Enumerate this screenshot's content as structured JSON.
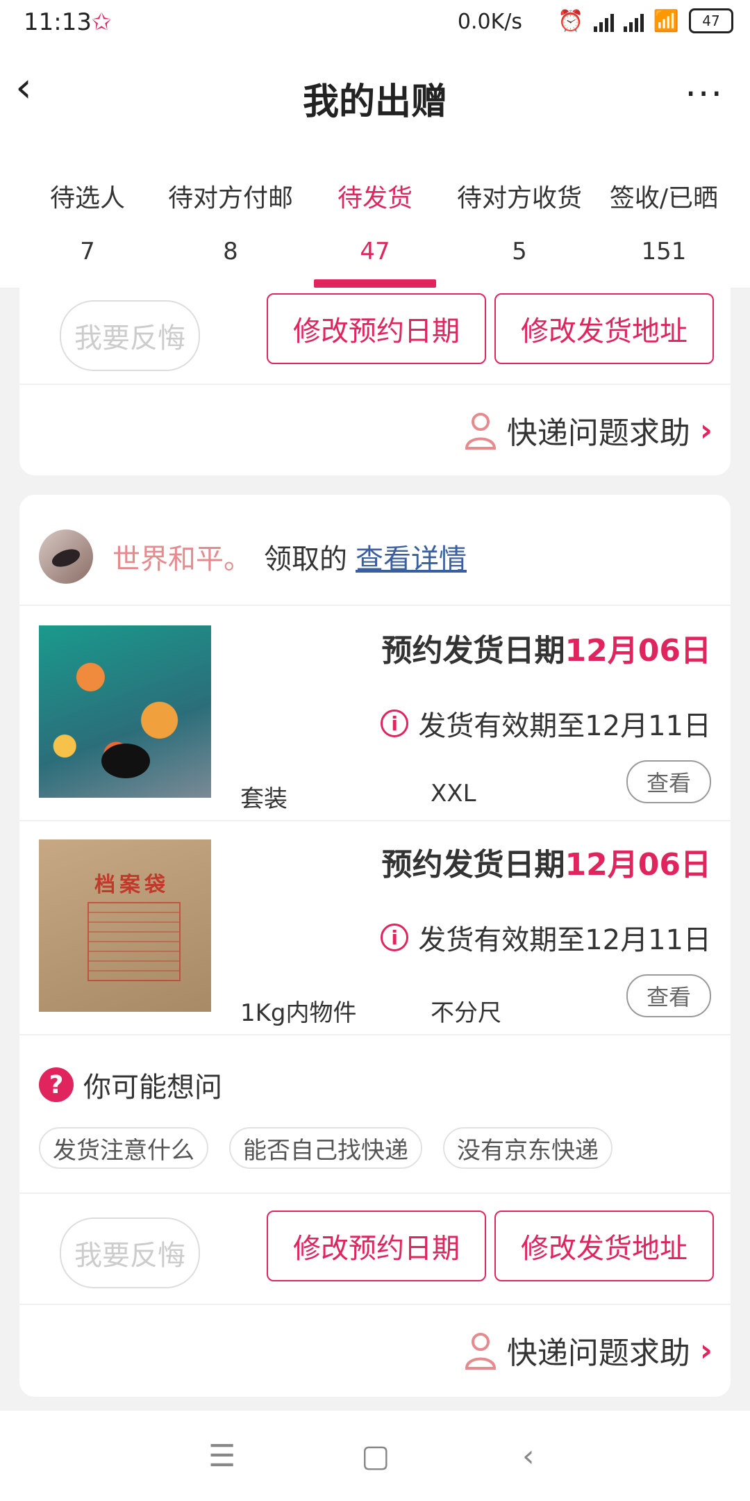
{
  "status_bar": {
    "time": "11:13",
    "network_speed": "0.0K/s",
    "battery": "47"
  },
  "header": {
    "title": "我的出赠"
  },
  "tabs": [
    {
      "label": "待选人",
      "count": "7"
    },
    {
      "label": "待对方付邮",
      "count": "8"
    },
    {
      "label": "待发货",
      "count": "47",
      "active": true
    },
    {
      "label": "待对方收货",
      "count": "5"
    },
    {
      "label": "签收/已晒",
      "count": "151"
    }
  ],
  "actions": {
    "regret": "我要反悔",
    "change_date": "修改预约日期",
    "change_address": "修改发货地址",
    "courier_help": "快递问题求助"
  },
  "order": {
    "user": "世界和平。",
    "received_text": "领取的",
    "detail_link": "查看详情",
    "items": [
      {
        "date_label": "预约发货日期",
        "date": "12月06日",
        "valid": "发货有效期至12月11日",
        "attr1": "套装",
        "attr2": "XXL",
        "view": "查看"
      },
      {
        "date_label": "预约发货日期",
        "date": "12月06日",
        "valid": "发货有效期至12月11日",
        "attr1": "1Kg内物件",
        "attr2": "不分尺",
        "view": "查看",
        "thumb_text": "档案袋"
      }
    ]
  },
  "faq": {
    "title": "你可能想问",
    "chips": [
      "发货注意什么",
      "能否自己找快递",
      "没有京东快递"
    ]
  },
  "colors": {
    "accent": "#e0245e"
  }
}
